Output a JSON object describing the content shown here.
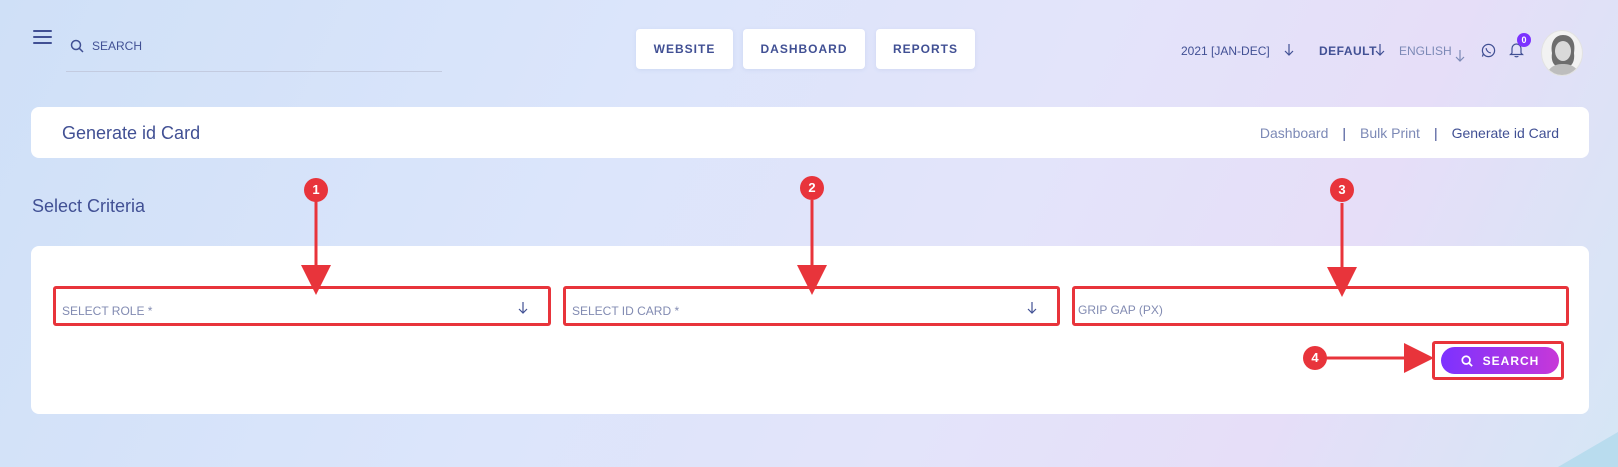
{
  "topbar": {
    "search_placeholder": "SEARCH",
    "nav": [
      "WEBSITE",
      "DASHBOARD",
      "REPORTS"
    ],
    "year": "2021 [JAN-DEC]",
    "theme": "DEFAULT",
    "language": "ENGLISH",
    "notification_count": "0"
  },
  "header": {
    "title": "Generate id Card",
    "breadcrumb": [
      "Dashboard",
      "Bulk Print",
      "Generate id Card"
    ]
  },
  "criteria": {
    "title": "Select Criteria",
    "role_placeholder": "SELECT ROLE *",
    "idcard_placeholder": "SELECT ID CARD *",
    "gap_placeholder": "GRIP GAP (PX)",
    "search_label": "SEARCH"
  },
  "annotations": [
    "1",
    "2",
    "3",
    "4"
  ],
  "colors": {
    "accent": "#7c32ff",
    "annotation": "#e8343b",
    "text": "#415094"
  }
}
